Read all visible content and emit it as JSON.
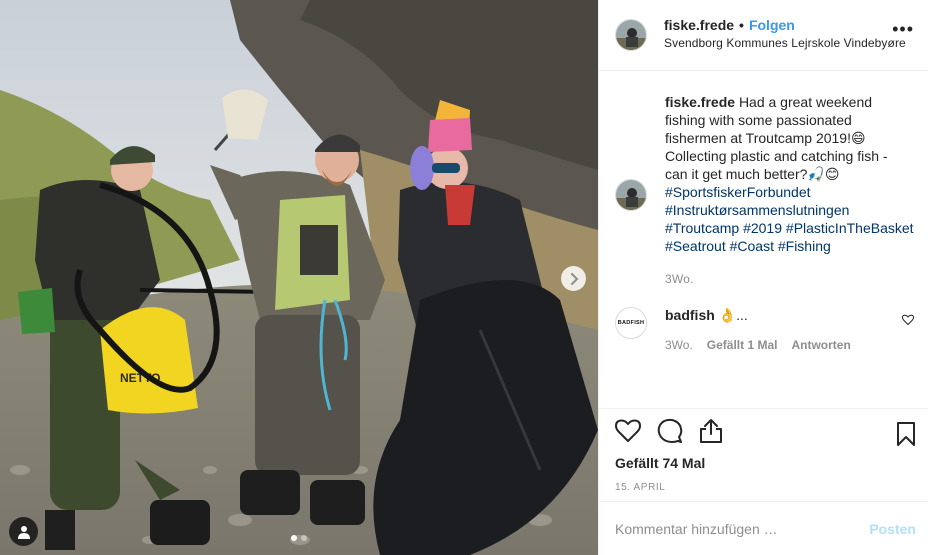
{
  "header": {
    "username": "fiske.frede",
    "separator": "•",
    "follow_label": "Folgen",
    "location": "Svendborg Kommunes Lejrskole Vindebyøre",
    "more_icon": "more-horizontal-icon"
  },
  "caption": {
    "username": "fiske.frede",
    "text_line1": "Had a great weekend fishing with some passionated fishermen at Troutcamp 2019!😄 Collecting plastic and catching fish - can it get much better?🎣😊",
    "hashtags": [
      "#SportsfiskerForbundet",
      "#Instruktørsammenslutningen",
      "#Troutcamp",
      "#2019",
      "#PlasticInTheBasket",
      "#Seatrout",
      "#Coast",
      "#Fishing"
    ],
    "time": "3Wo."
  },
  "comment": {
    "avatar_text": "BADFISH",
    "username": "badfish",
    "text": "👌...",
    "time": "3Wo.",
    "likes": "Gefällt 1 Mal",
    "reply": "Antworten"
  },
  "actions": {
    "likes_text": "Gefällt 74 Mal",
    "date": "15. APRIL"
  },
  "add_comment": {
    "placeholder": "Kommentar hinzufügen …",
    "post_label": "Posten"
  },
  "colors": {
    "link_blue": "#3897f0",
    "hashtag": "#003569",
    "muted": "#8e8e8e",
    "post_disabled": "#b2dffc"
  },
  "carousel": {
    "total": 2,
    "active": 1
  }
}
